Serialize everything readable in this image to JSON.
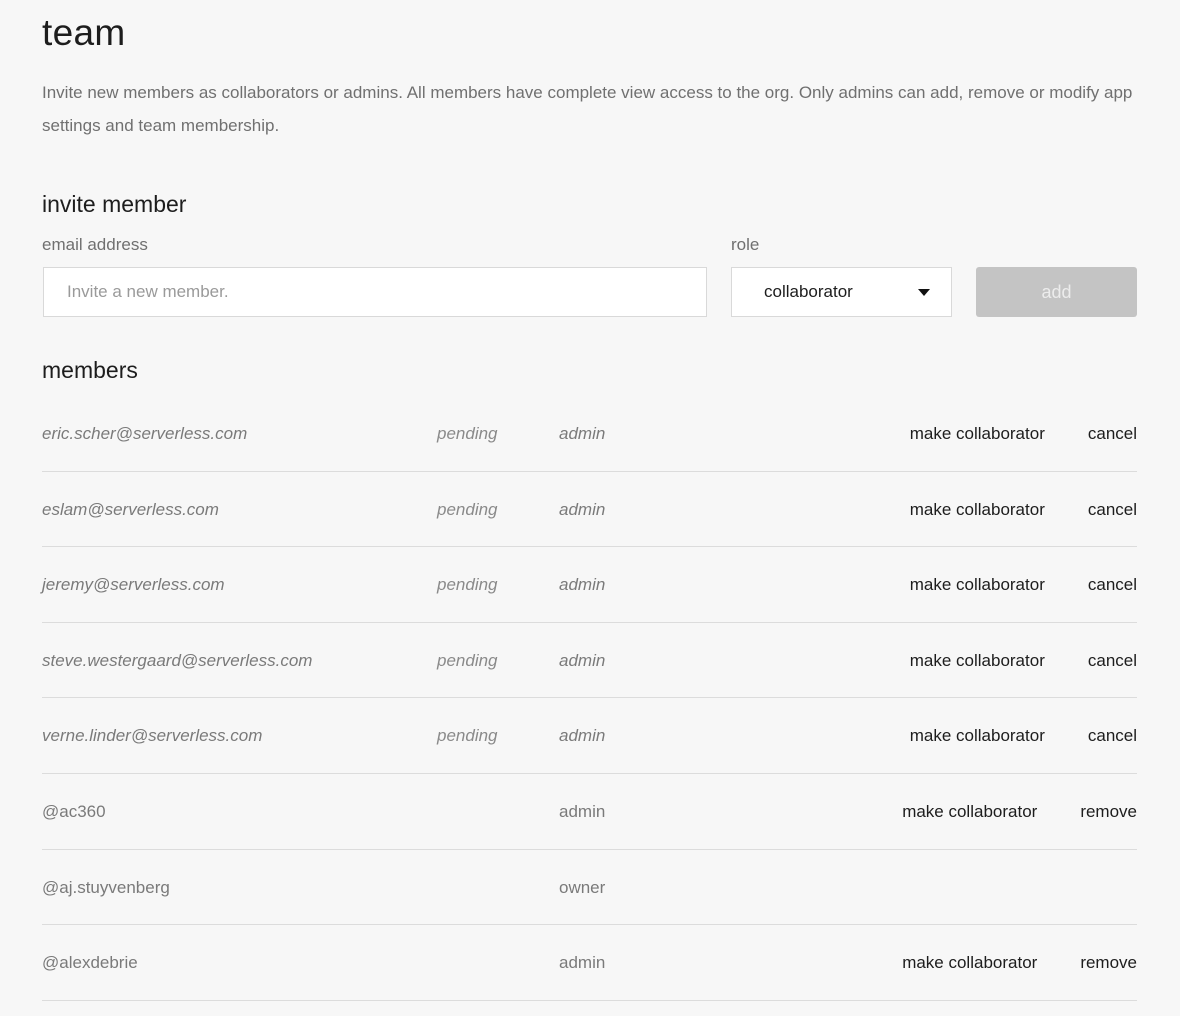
{
  "page": {
    "title": "team",
    "description": "Invite new members as collaborators or admins. All members have complete view access to the org. Only admins can add, remove or modify app settings and team membership."
  },
  "invite": {
    "heading": "invite member",
    "email_label": "email address",
    "email_placeholder": "Invite a new member.",
    "email_value": "",
    "role_label": "role",
    "role_value": "collaborator",
    "role_caret_icon": "caret-down-icon",
    "add_label": "add"
  },
  "members": {
    "heading": "members",
    "rows": [
      {
        "email": "eric.scher@serverless.com",
        "status": "pending",
        "role": "admin",
        "actions": [
          "make collaborator",
          "cancel"
        ]
      },
      {
        "email": "eslam@serverless.com",
        "status": "pending",
        "role": "admin",
        "actions": [
          "make collaborator",
          "cancel"
        ]
      },
      {
        "email": "jeremy@serverless.com",
        "status": "pending",
        "role": "admin",
        "actions": [
          "make collaborator",
          "cancel"
        ]
      },
      {
        "email": "steve.westergaard@serverless.com",
        "status": "pending",
        "role": "admin",
        "actions": [
          "make collaborator",
          "cancel"
        ]
      },
      {
        "email": "verne.linder@serverless.com",
        "status": "pending",
        "role": "admin",
        "actions": [
          "make collaborator",
          "cancel"
        ]
      },
      {
        "email": "@ac360",
        "status": "",
        "role": "admin",
        "actions": [
          "make collaborator",
          "remove"
        ]
      },
      {
        "email": "@aj.stuyvenberg",
        "status": "",
        "role": "owner",
        "actions": []
      },
      {
        "email": "@alexdebrie",
        "status": "",
        "role": "admin",
        "actions": [
          "make collaborator",
          "remove"
        ]
      }
    ]
  }
}
